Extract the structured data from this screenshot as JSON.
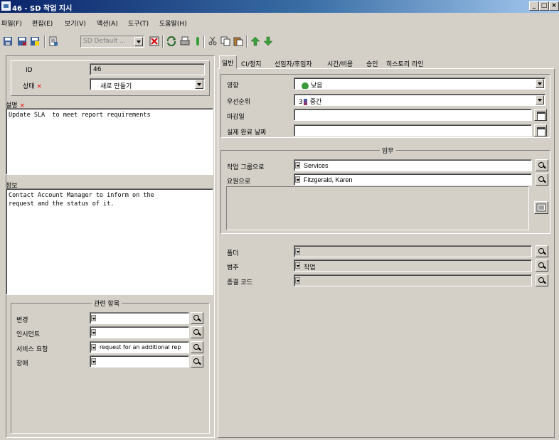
{
  "window": {
    "title": "46 - SD 작업 지시",
    "min_glyph": "_",
    "max_glyph": "□",
    "close_glyph": "×"
  },
  "menu": [
    "파일(F)",
    "편집(E)",
    "보기(V)",
    "액션(A)",
    "도구(T)",
    "도움말(H)"
  ],
  "toolbar": {
    "template_select": "SD Default ..."
  },
  "left": {
    "id_label": "ID",
    "id_value": "46",
    "status_label": "상태",
    "status_value": "새로 만들기",
    "required_mark": "×",
    "description_label": "설명",
    "description_value": "Update SLA  to meet report requirements",
    "info_label": "정보",
    "info_value": "Contact Account Manager to inform on the\nrequest and the status of it.",
    "related_title": "관련 항목",
    "related": [
      {
        "label": "변경",
        "value": ""
      },
      {
        "label": "인시던트",
        "value": ""
      },
      {
        "label": "서비스 요청",
        "value": "request for an additional rep"
      },
      {
        "label": "장애",
        "value": ""
      }
    ]
  },
  "tabs": [
    "일반",
    "CI/정지",
    "선임자/후임자",
    "시간/비용",
    "승인",
    "히스토리 라인"
  ],
  "general": {
    "impact_label": "영향",
    "impact_value": "낮음",
    "priority_label": "우선순위",
    "priority_value": "중간",
    "priority_number": "3",
    "deadline_label": "마감일",
    "deadline_value": "",
    "actual_done_label": "실제 완료 날짜",
    "actual_done_value": "",
    "assignment_title": "임무",
    "workgroup_label": "작업 그룹으로",
    "workgroup_value": "Services",
    "person_label": "요원으로",
    "person_value": "Fitzgerald, Karen",
    "folder_label": "폴더",
    "folder_value": "",
    "category_label": "범주",
    "category_value": "작업",
    "closure_label": "종결 코드",
    "closure_value": ""
  },
  "colors": {
    "title_start": "#0a246a",
    "title_end": "#a6caf0",
    "required": "#ee0000",
    "face": "#d4d0c8"
  }
}
